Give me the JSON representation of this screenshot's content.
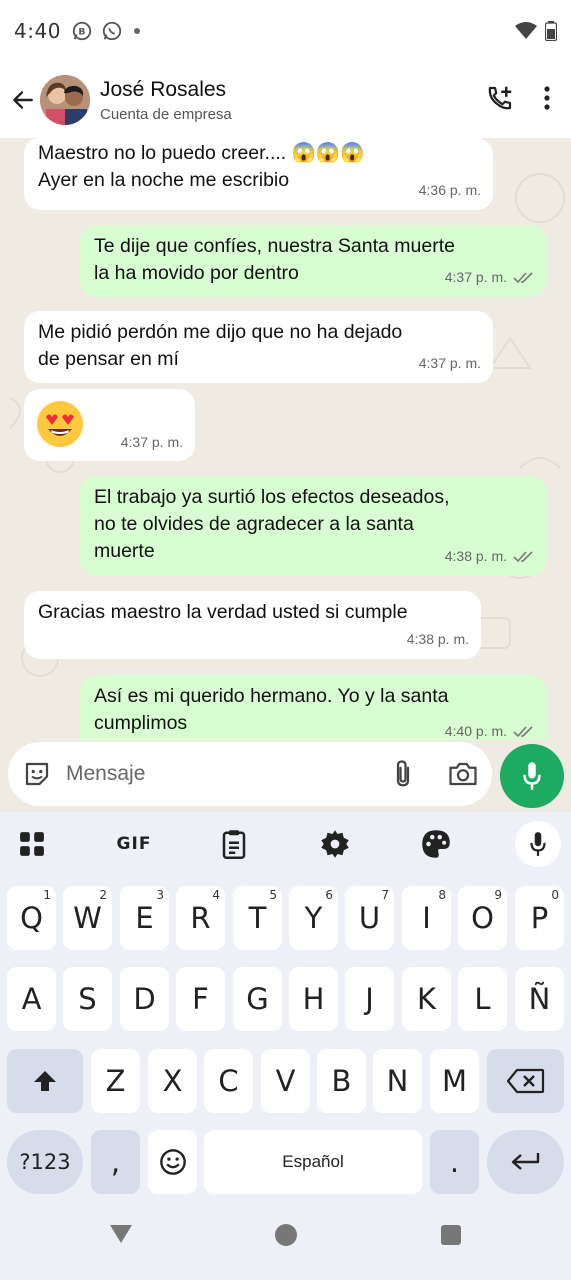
{
  "status_bar": {
    "time": "4:40",
    "left_icons": [
      "whatsapp-business-icon",
      "whatsapp-icon",
      "dot-icon"
    ],
    "right_icons": [
      "wifi-icon",
      "battery-icon"
    ]
  },
  "header": {
    "name": "José Rosales",
    "subtitle": "Cuenta de empresa",
    "icons": [
      "back-arrow-icon",
      "add-call-icon",
      "more-vert-icon"
    ]
  },
  "messages": [
    {
      "dir": "in",
      "text": "Maestro no lo puedo creer.... 😱😱😱\nAyer en la noche me escribio",
      "time": "4:36 p. m."
    },
    {
      "dir": "out",
      "text": "Te dije que confíes, nuestra Santa muerte\nla ha movido por dentro",
      "time": "4:37 p. m.",
      "status": "read"
    },
    {
      "dir": "in",
      "text": "Me pidió perdón me dijo que no ha dejado\nde pensar en mí",
      "time": "4:37 p. m."
    },
    {
      "dir": "in",
      "text": "😍",
      "time": "4:37 p. m."
    },
    {
      "dir": "out",
      "text": "El trabajo ya surtió los efectos deseados,\nno te olvides de agradecer a la santa\nmuerte",
      "time": "4:38 p. m.",
      "status": "read"
    },
    {
      "dir": "in",
      "text": "Gracias maestro la verdad usted si cumple",
      "time": "4:38 p. m."
    },
    {
      "dir": "out",
      "text": "Así es mi querido hermano. Yo y la santa\ncumplimos",
      "time": "4:40 p. m.",
      "status": "read"
    }
  ],
  "input": {
    "placeholder": "Mensaje",
    "icons": [
      "sticker-icon",
      "attach-icon",
      "camera-icon",
      "mic-icon"
    ]
  },
  "keyboard": {
    "toolbar": {
      "gif_label": "GIF",
      "icons": [
        "apps-grid-icon",
        "clipboard-icon",
        "settings-gear-icon",
        "palette-icon",
        "mic-icon"
      ]
    },
    "row1": [
      {
        "k": "Q",
        "h": "1"
      },
      {
        "k": "W",
        "h": "2"
      },
      {
        "k": "E",
        "h": "3"
      },
      {
        "k": "R",
        "h": "4"
      },
      {
        "k": "T",
        "h": "5"
      },
      {
        "k": "Y",
        "h": "6"
      },
      {
        "k": "U",
        "h": "7"
      },
      {
        "k": "I",
        "h": "8"
      },
      {
        "k": "O",
        "h": "9"
      },
      {
        "k": "P",
        "h": "0"
      }
    ],
    "row2": [
      "A",
      "S",
      "D",
      "F",
      "G",
      "H",
      "J",
      "K",
      "L",
      "Ñ"
    ],
    "row3": [
      "Z",
      "X",
      "C",
      "V",
      "B",
      "N",
      "M"
    ],
    "symbols_label": "?123",
    "comma_label": ",",
    "space_label": "Español",
    "period_label": ".",
    "colors": {
      "special_key": "#d6dcea",
      "key": "#ffffff",
      "background": "#eef0f7"
    }
  },
  "navbar": {
    "icons": [
      "back-triangle-icon",
      "home-circle-icon",
      "recents-square-icon"
    ]
  },
  "colors": {
    "chat_bg": "#efeae2",
    "bubble_in": "#ffffff",
    "bubble_out": "#d9fdd3",
    "accent_green": "#1daa61"
  }
}
